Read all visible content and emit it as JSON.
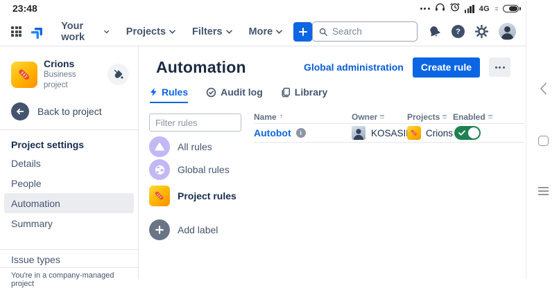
{
  "status_bar": {
    "time": "23:48",
    "network_label": "4G"
  },
  "nav": {
    "menu": [
      {
        "label": "Your work"
      },
      {
        "label": "Projects"
      },
      {
        "label": "Filters"
      },
      {
        "label": "More"
      }
    ],
    "search_placeholder": "Search"
  },
  "sidebar": {
    "project_name": "Crions",
    "project_type": "Business project",
    "back_label": "Back to project",
    "section_title": "Project settings",
    "menu": [
      {
        "label": "Details",
        "selected": false
      },
      {
        "label": "People",
        "selected": false
      },
      {
        "label": "Automation",
        "selected": true
      },
      {
        "label": "Summary",
        "selected": false
      }
    ],
    "issue_types_label": "Issue types",
    "footer_note": "You're in a company-managed project"
  },
  "main": {
    "title": "Automation",
    "global_admin_label": "Global administration",
    "create_rule_label": "Create rule",
    "tabs": [
      {
        "label": "Rules",
        "active": true
      },
      {
        "label": "Audit log",
        "active": false
      },
      {
        "label": "Library",
        "active": false
      }
    ],
    "filter_placeholder": "Filter rules",
    "rule_groups": [
      {
        "label": "All rules",
        "icon": "tent",
        "selected": false
      },
      {
        "label": "Global rules",
        "icon": "globe",
        "selected": false
      },
      {
        "label": "Project rules",
        "icon": "project-avatar",
        "selected": true
      },
      {
        "label": "Add label",
        "icon": "plus",
        "selected": false
      }
    ],
    "table": {
      "columns": [
        {
          "label": "Name",
          "sort": "asc"
        },
        {
          "label": "Owner",
          "sort": "none"
        },
        {
          "label": "Projects",
          "sort": "none"
        },
        {
          "label": "Enabled",
          "sort": "none"
        }
      ],
      "rows": [
        {
          "name": "Autobot",
          "owner": "KOSASIH",
          "project": "Crions",
          "enabled": true
        }
      ]
    }
  },
  "colors": {
    "accent_blue": "#0C66E4",
    "link_blue": "#0B5CD7",
    "toggle_on_green": "#1E8152",
    "lavender_icon_bg": "#C3B8F5",
    "project_avatar_gradient": [
      "#FFD83D",
      "#FF8F00"
    ],
    "selected_item_bg": "#EBECF0",
    "dark_text": "#172B4D",
    "mid_text": "#44546F",
    "muted_text": "#626F86"
  },
  "icons": {
    "app_switcher": "3x3-dot-grid",
    "jira_logo": "double-chevron-up-right",
    "chevron_down": "v",
    "plus": "+",
    "search": "magnifier",
    "notifications": "bell",
    "help": "? in circle",
    "settings": "gear",
    "avatar": "person photo",
    "theme": "paint-bucket",
    "back": "left-arrow in circle",
    "rules_tab": "lightning",
    "audit_tab": "check-circle",
    "library_tab": "pages",
    "all_rules": "white tent on lavender circle",
    "global_rules": "globe on lavender circle",
    "add_label": "plus on slate circle",
    "info": "i in circle",
    "enabled_toggle": "check + knob",
    "android_back": "chevron-left",
    "android_home": "square",
    "android_recents": "three-lines",
    "status": [
      "three-dots",
      "headset",
      "alarm-clock",
      "signal-bars",
      "4G",
      "battery"
    ]
  }
}
